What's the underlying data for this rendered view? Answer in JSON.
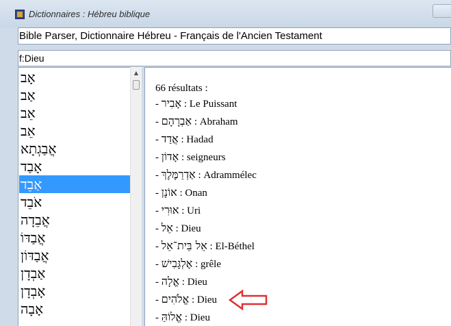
{
  "window": {
    "title": "Dictionnaires : Hébreu biblique"
  },
  "dictionary": {
    "value": "Bible Parser, Dictionnaire Hébreu - Français de l'Ancien Testament"
  },
  "search": {
    "value": "f:Dieu"
  },
  "word_list": {
    "items": [
      {
        "text": "אָב"
      },
      {
        "text": "אַב"
      },
      {
        "text": "אֵב"
      },
      {
        "text": "אֵב"
      },
      {
        "text": "אֲבַגְתָא"
      },
      {
        "text": "אָבַד"
      },
      {
        "text": "אַבֵד",
        "selected": true
      },
      {
        "text": "אֹבֵד"
      },
      {
        "text": "אֲבֵדָה"
      },
      {
        "text": "אֲבַדּוֹ"
      },
      {
        "text": "אֲבַדּוֹן"
      },
      {
        "text": "אַבְדָן"
      },
      {
        "text": "אָבְדָן"
      },
      {
        "text": "אָבָה"
      }
    ]
  },
  "results": {
    "count_label": "66 résultats :",
    "rows": [
      {
        "prefix": "- ",
        "hebrew": "אָבִיר",
        "gloss": " : Le Puissant"
      },
      {
        "prefix": "- ",
        "hebrew": "אַבְרָהָם",
        "gloss": " : Abraham"
      },
      {
        "prefix": "- ",
        "hebrew": "אֲדַד",
        "gloss": " : Hadad"
      },
      {
        "prefix": "- ",
        "hebrew": "אָדוֹן",
        "gloss": " : seigneurs"
      },
      {
        "prefix": "- ",
        "hebrew": "אַדְרַמֶּלֶךְ",
        "gloss": " : Adrammélec"
      },
      {
        "prefix": "- ",
        "hebrew": "אוֹנָן",
        "gloss": " : Onan"
      },
      {
        "prefix": "- ",
        "hebrew": "אוּרִי",
        "gloss": " : Uri"
      },
      {
        "prefix": "- ",
        "hebrew": "אֵל",
        "gloss": " : Dieu"
      },
      {
        "prefix": "- ",
        "hebrew": "אֵל בֵּית־אֵל",
        "gloss": " : El-Béthel"
      },
      {
        "prefix": "- ",
        "hebrew": "אֶלְגָּבִישׁ",
        "gloss": " : grêle"
      },
      {
        "prefix": "- ",
        "hebrew": "אֱלָה",
        "gloss": " : Dieu"
      },
      {
        "prefix": "- ",
        "hebrew": "אֱלֹהִים",
        "gloss": " : Dieu"
      },
      {
        "prefix": "- ",
        "hebrew": "אֱלוֹהַּ",
        "gloss": " : Dieu"
      }
    ]
  },
  "annotation": {
    "arrow_color": "#e03030",
    "icon": "left-arrow-icon"
  },
  "colors": {
    "selection": "#3399ff",
    "frame": "#cfdbe8"
  }
}
